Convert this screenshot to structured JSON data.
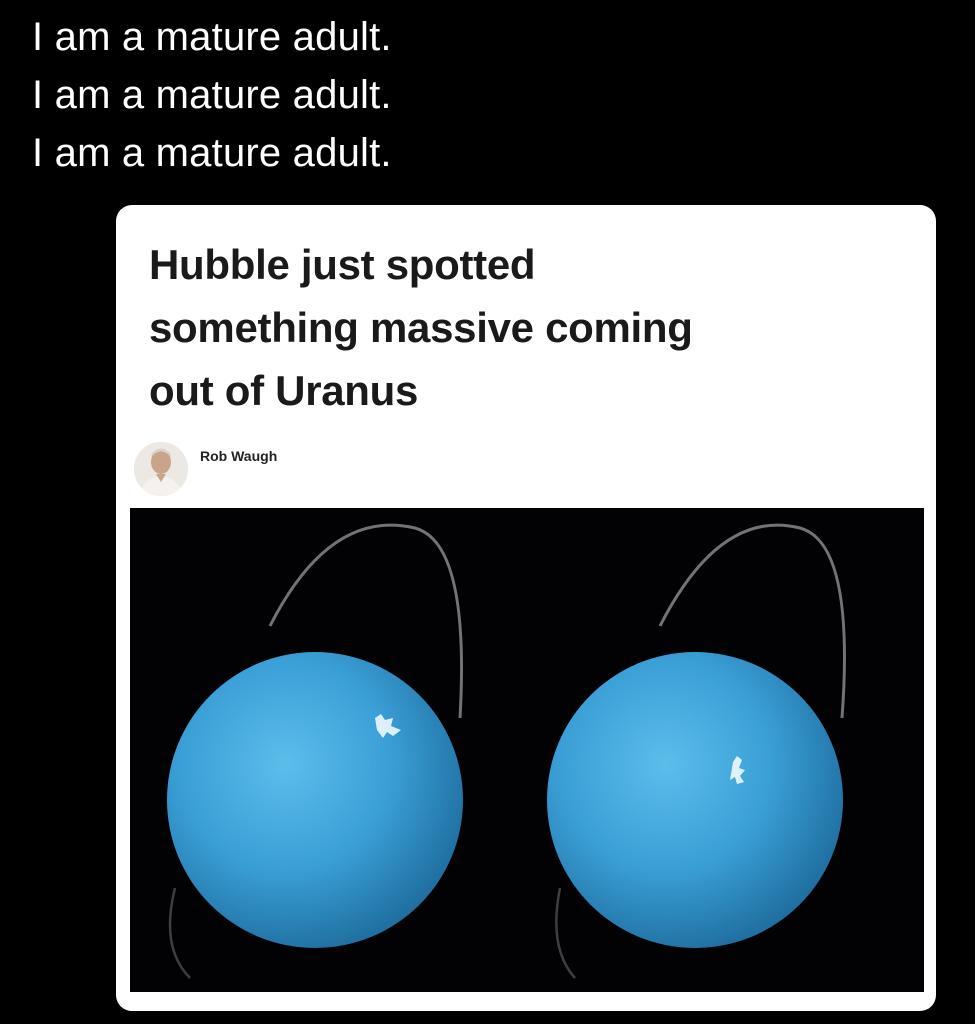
{
  "caption": {
    "lines": [
      "I am a mature adult.",
      "I am a mature adult.",
      "I am a mature adult."
    ]
  },
  "article": {
    "headline_lines": [
      "Hubble just spotted",
      "something massive coming",
      "out of Uranus"
    ],
    "author": "Rob Waugh",
    "photo_colors": {
      "planet": "#3a9fd6",
      "planet_light": "#57b5e6",
      "ring": "#9a9a9a",
      "background": "#020205"
    }
  }
}
